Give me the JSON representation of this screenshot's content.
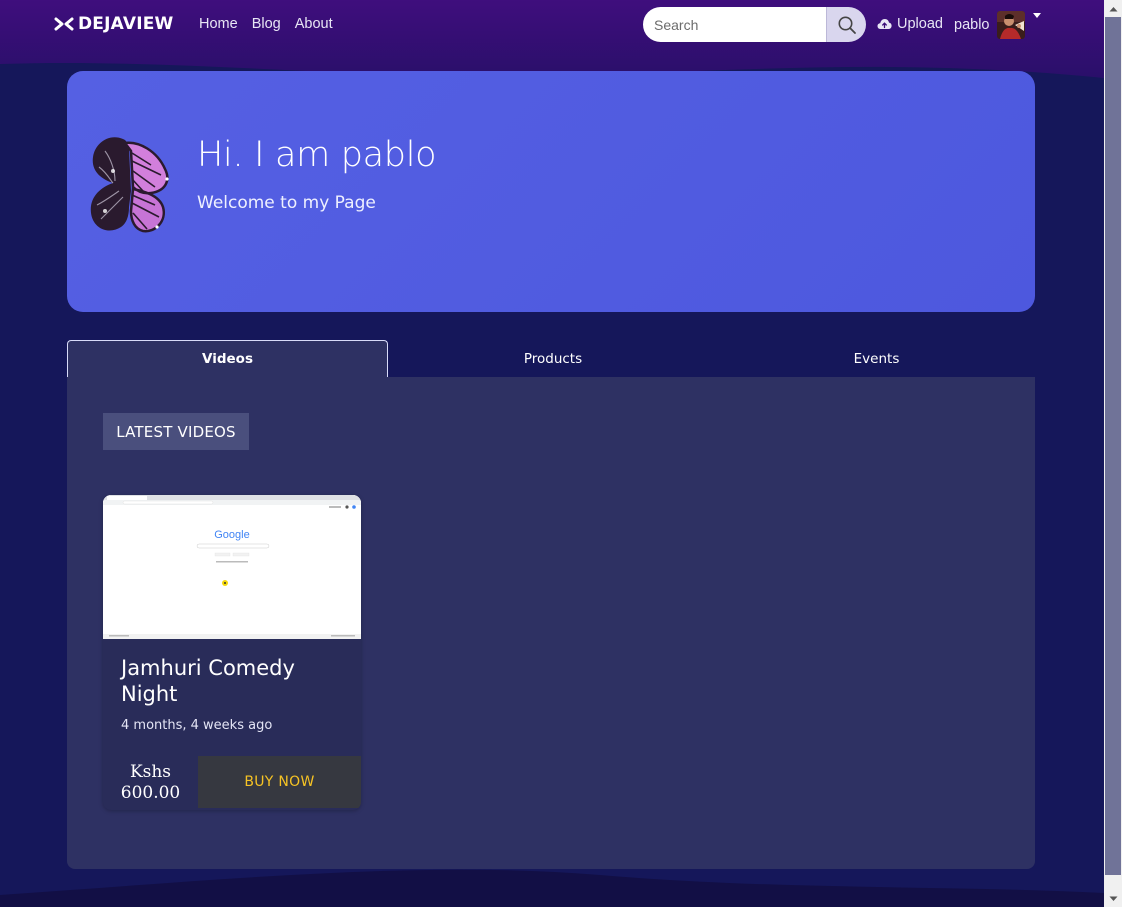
{
  "navbar": {
    "brand": "DEJAVIEW",
    "links": [
      "Home",
      "Blog",
      "About"
    ],
    "search_placeholder": "Search",
    "upload_label": "Upload",
    "username": "pablo"
  },
  "hero": {
    "title": "Hi. I am pablo",
    "subtitle": "Welcome to my Page"
  },
  "tabs": [
    {
      "label": "Videos",
      "active": true
    },
    {
      "label": "Products",
      "active": false
    },
    {
      "label": "Events",
      "active": false
    }
  ],
  "section": {
    "label": "LATEST VIDEOS"
  },
  "videos": [
    {
      "title": "Jamhuri Comedy Night",
      "time": "4 months, 4 weeks ago",
      "price_currency": "Kshs",
      "price_amount": "600.00",
      "buy_label": "BUY NOW",
      "thumbnail_text": "Google"
    }
  ],
  "colors": {
    "background": "#15175a",
    "hero": "#5560e3",
    "panel": "#2e3163",
    "buy_text": "#f6c324",
    "nav_top": "#3a0d79"
  }
}
